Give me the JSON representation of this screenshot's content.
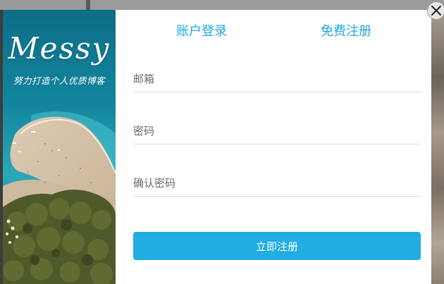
{
  "sidebar": {
    "brand": "Messy",
    "slogan": "努力打造个人优质博客"
  },
  "tabs": {
    "login": "账户登录",
    "register": "免费注册"
  },
  "form": {
    "email_placeholder": "邮箱",
    "password_placeholder": "密码",
    "confirm_placeholder": "确认密码",
    "submit_label": "立即注册"
  },
  "colors": {
    "accent": "#21ade1",
    "tab_text": "#1fa7e1",
    "divider": "#dcdcdc"
  },
  "icons": {
    "close": "close-icon"
  }
}
